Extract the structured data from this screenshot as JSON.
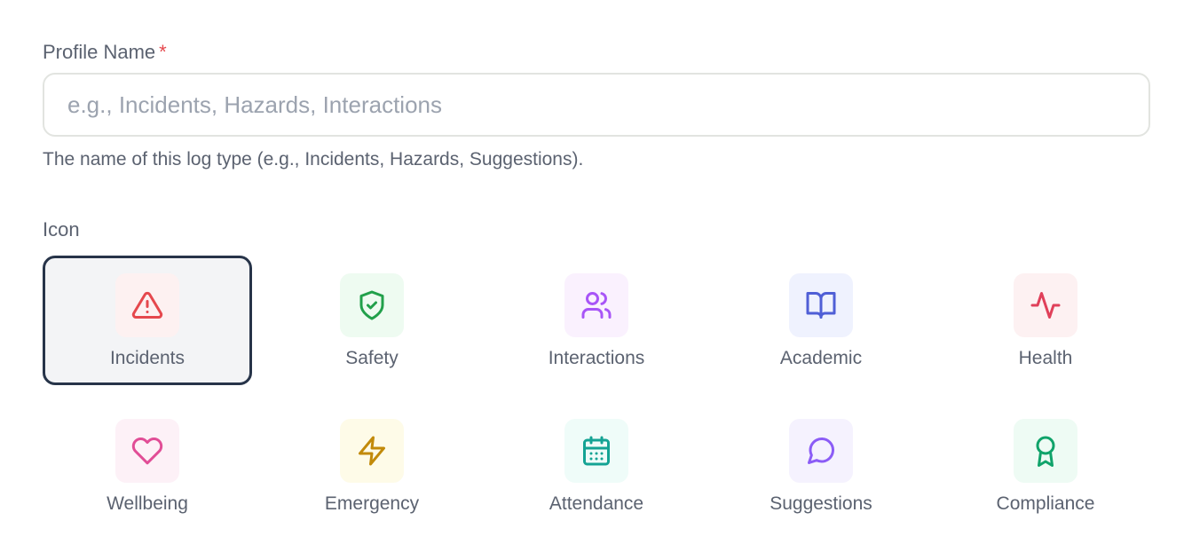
{
  "form": {
    "profile_name": {
      "label": "Profile Name",
      "required_mark": "*",
      "value": "",
      "placeholder": "e.g., Incidents, Hazards, Interactions",
      "helper": "The name of this log type (e.g., Incidents, Hazards, Suggestions)."
    },
    "icon": {
      "label": "Icon",
      "selected": "Incidents",
      "options": [
        {
          "label": "Incidents",
          "icon": "alert-triangle-icon",
          "color": "#e5484d",
          "bg": "#fdf1f1"
        },
        {
          "label": "Safety",
          "icon": "shield-check-icon",
          "color": "#22a04b",
          "bg": "#eefbf1"
        },
        {
          "label": "Interactions",
          "icon": "users-icon",
          "color": "#a855f7",
          "bg": "#faf1fe"
        },
        {
          "label": "Academic",
          "icon": "book-open-icon",
          "color": "#4f5fd6",
          "bg": "#eff2fe"
        },
        {
          "label": "Health",
          "icon": "activity-icon",
          "color": "#e0405a",
          "bg": "#fdf1f2"
        },
        {
          "label": "Wellbeing",
          "icon": "heart-icon",
          "color": "#e14d96",
          "bg": "#fdf1f7"
        },
        {
          "label": "Emergency",
          "icon": "zap-icon",
          "color": "#c28a0a",
          "bg": "#fefbe8"
        },
        {
          "label": "Attendance",
          "icon": "calendar-icon",
          "color": "#14a394",
          "bg": "#effcf9"
        },
        {
          "label": "Suggestions",
          "icon": "message-circle-icon",
          "color": "#8b5cf6",
          "bg": "#f5f2fe"
        },
        {
          "label": "Compliance",
          "icon": "award-icon",
          "color": "#10a36a",
          "bg": "#eefbf4"
        }
      ]
    }
  }
}
